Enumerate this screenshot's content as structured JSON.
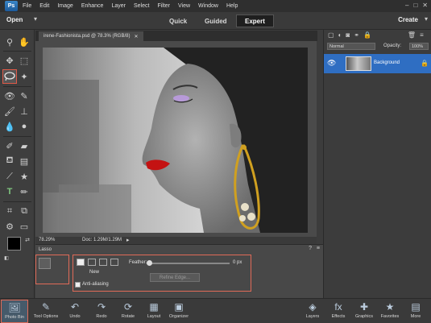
{
  "menubar": {
    "logo": "Ps",
    "items": [
      "File",
      "Edit",
      "Image",
      "Enhance",
      "Layer",
      "Select",
      "Filter",
      "View",
      "Window",
      "Help"
    ]
  },
  "modebar": {
    "open_label": "Open",
    "modes": [
      "Quick",
      "Guided",
      "Expert"
    ],
    "active_mode": "Expert",
    "create_label": "Create"
  },
  "document": {
    "tab_title": "irene-Fashionista.psd @ 78.3% (RGB/8)",
    "zoom": "78.29%",
    "doc_info": "Doc: 1.29M/1.29M"
  },
  "tool_options": {
    "tool_name": "Lasso",
    "new_label": "New",
    "anti_alias_label": "Anti-aliasing",
    "feather_label": "Feather:",
    "feather_value": "0 px",
    "feather_fraction": 0.0,
    "refine_edge_label": "Refine Edge..."
  },
  "layers": {
    "blend_mode": "Normal",
    "opacity_label": "Opacity:",
    "opacity_value": "100%",
    "layer_name": "Background"
  },
  "bottombar": {
    "items": [
      "Photo Bin",
      "Tool Options",
      "Undo",
      "Redo",
      "Rotate",
      "Layout",
      "Organizer",
      "Layers",
      "Effects",
      "Graphics",
      "Favorites",
      "More"
    ]
  },
  "colors": {
    "accent_highlight": "#e05a48",
    "layer_selected": "#2f6ec2"
  }
}
